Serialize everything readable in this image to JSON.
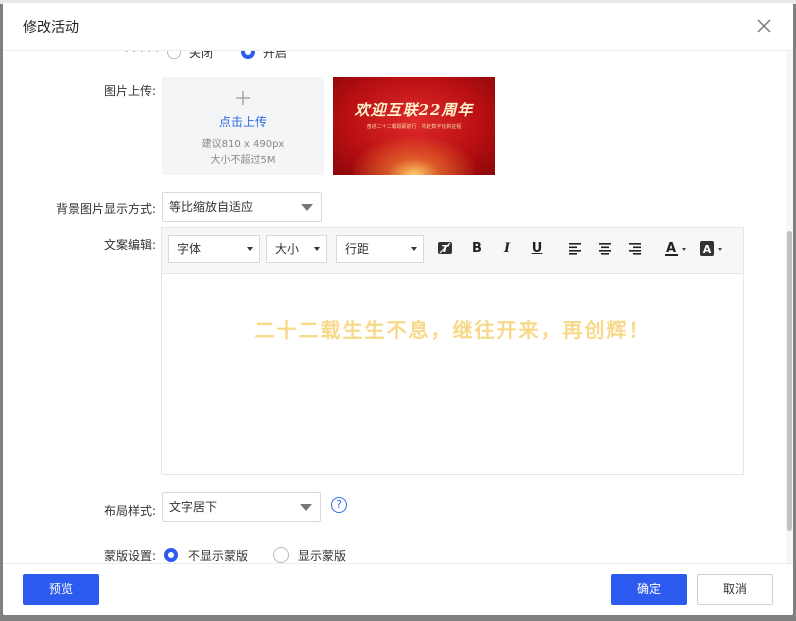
{
  "dialog": {
    "title": "修改活动",
    "close_icon": "close-icon"
  },
  "form": {
    "top_row": {
      "label": "...",
      "options": [
        "关闭",
        "开启"
      ],
      "selected": "开启"
    },
    "image_upload": {
      "label": "图片上传:",
      "plus_icon": "plus-icon",
      "action": "点击上传",
      "hint_size": "建议810 x 490px",
      "hint_limit": "大小不超过5M",
      "preview": {
        "title": "欢迎互联22周年",
        "subtitle": "奋进二十二载砥砺前行 · 共赴数字化新征程"
      }
    },
    "bg_display": {
      "label": "背景图片显示方式:",
      "value": "等比缩放自适应"
    },
    "copy_editor": {
      "label": "文案编辑:",
      "toolbar": {
        "font": "字体",
        "size": "大小",
        "line_height": "行距",
        "buttons": [
          "clear-format-icon",
          "bold-icon",
          "italic-icon",
          "underline-icon",
          "align-left-icon",
          "align-center-icon",
          "align-right-icon",
          "font-color-icon",
          "background-color-icon"
        ]
      },
      "content": "二十二载生生不息，继往开来，再创辉！",
      "content_color": "#f7d98a"
    },
    "layout": {
      "label": "布局样式:",
      "value": "文字居下",
      "help": "?"
    },
    "mask": {
      "label": "蒙版设置:",
      "options": [
        "不显示蒙版",
        "显示蒙版"
      ],
      "selected": "不显示蒙版"
    }
  },
  "footer": {
    "preview": "预览",
    "confirm": "确定",
    "cancel": "取消"
  },
  "colors": {
    "primary": "#2e5bef",
    "link": "#2e6be6"
  }
}
